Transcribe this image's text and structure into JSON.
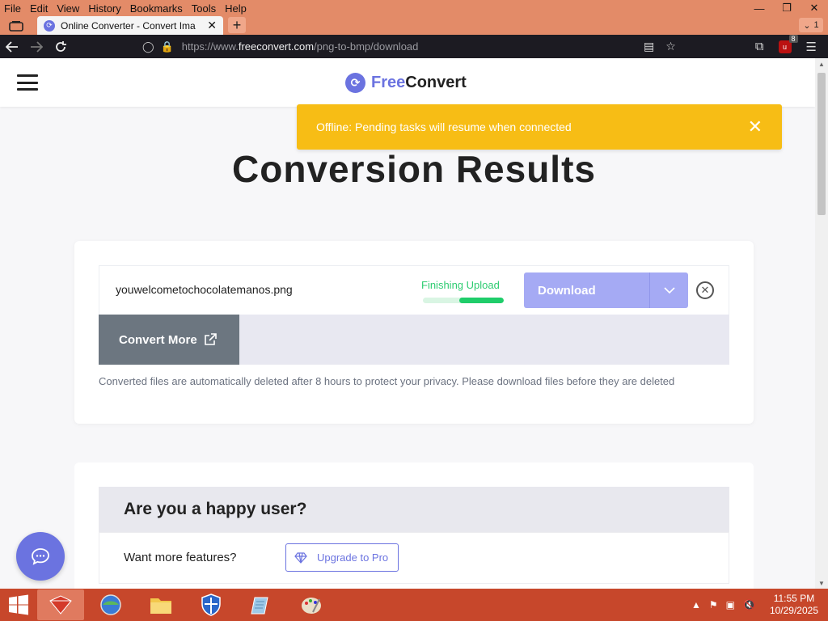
{
  "browser": {
    "menu": [
      "File",
      "Edit",
      "View",
      "History",
      "Bookmarks",
      "Tools",
      "Help"
    ],
    "tab_title": "Online Converter - Convert Ima",
    "tab_count": "1",
    "url_prefix": "https://www.",
    "url_host": "freeconvert.com",
    "url_path": "/png-to-bmp/download",
    "ublock_badge": "8"
  },
  "site": {
    "logo_free": "Free",
    "logo_convert": "Convert"
  },
  "toast": {
    "message": "Offline: Pending tasks will resume when connected"
  },
  "main": {
    "title": "Conversion Results",
    "file_name": "youwelcometochocolatemanos.png",
    "status": "Finishing Upload",
    "progress_fraction": 0.55,
    "download_label": "Download",
    "convert_more_label": "Convert More",
    "privacy_note": "Converted files are automatically deleted after 8 hours to protect your privacy. Please download files before they are deleted"
  },
  "happy": {
    "heading": "Are you a happy user?",
    "question": "Want more features?",
    "upgrade_label": "Upgrade to Pro"
  },
  "taskbar": {
    "time": "11:55 PM",
    "date": "10/29/2025"
  },
  "colors": {
    "brand": "#6b73e0",
    "toast": "#f7bd15",
    "progress": "#1fcd6a"
  }
}
